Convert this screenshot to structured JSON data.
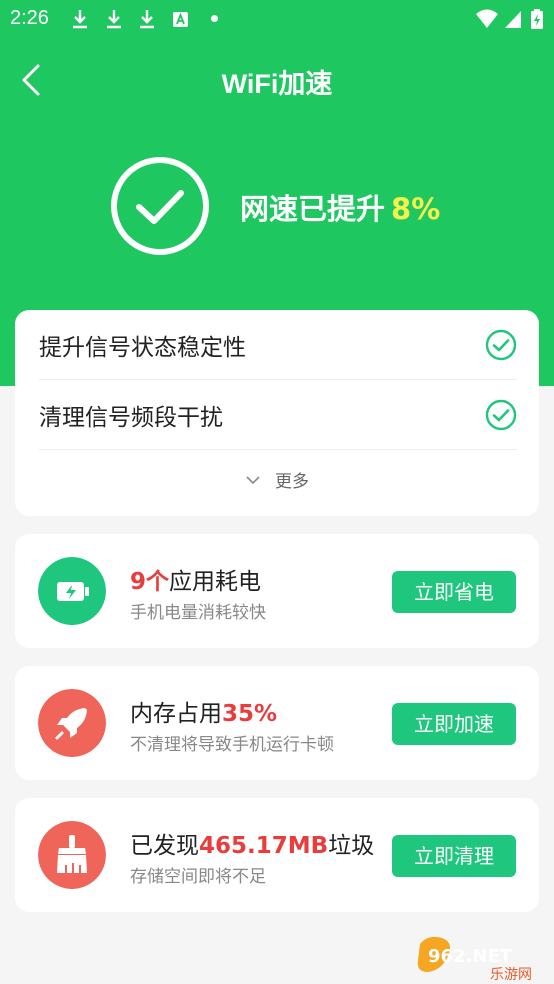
{
  "status_bar": {
    "time": "2:26",
    "icons": [
      "download-icon",
      "download-icon",
      "download-icon",
      "app-notification-icon",
      "dot-icon",
      "wifi-icon",
      "signal-icon",
      "battery-charging-icon"
    ]
  },
  "header": {
    "title": "WiFi加速",
    "back_icon": "chevron-left-icon"
  },
  "hero": {
    "text": "网速已提升",
    "percent": "8%"
  },
  "items": [
    {
      "label": "提升信号状态稳定性",
      "icon": "check-circle-icon"
    },
    {
      "label": "清理信号频段干扰",
      "icon": "check-circle-icon"
    }
  ],
  "more": {
    "label": "更多"
  },
  "actions": [
    {
      "highlight": "9个",
      "title_rest": "应用耗电",
      "subtitle": "手机电量消耗较快",
      "button": "立即省电",
      "icon": "battery-icon"
    },
    {
      "title_pre": "内存占用",
      "highlight": "35%",
      "subtitle": "不清理将导致手机运行卡顿",
      "button": "立即加速",
      "icon": "rocket-icon"
    },
    {
      "title_pre": "已发现",
      "highlight": "465.17MB",
      "title_rest": "垃圾",
      "subtitle": "存储空间即将不足",
      "button": "立即清理",
      "icon": "broom-icon"
    }
  ],
  "watermark": {
    "brand": "962.NET",
    "sub": "乐游网"
  },
  "colors": {
    "header_green": "#1ec760",
    "button_green": "#1ec77d",
    "highlight_yellow": "#f4f24b",
    "highlight_red": "#e93c3c",
    "battery_icon_bg": "#1ec77d",
    "rocket_icon_bg": "#f0655a",
    "broom_icon_bg": "#f0655a"
  }
}
